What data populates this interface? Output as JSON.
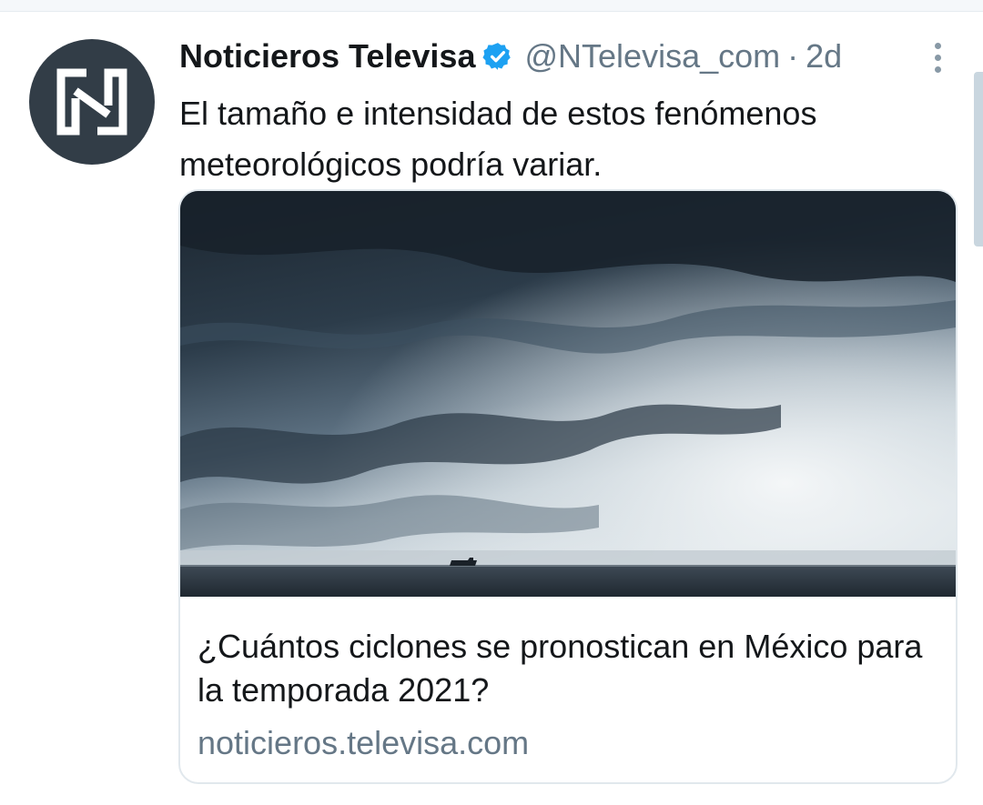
{
  "tweet": {
    "author": {
      "display_name": "Noticieros Televisa",
      "handle": "@NTelevisa_com",
      "verified": true,
      "avatar_icon": "noticieros-logo-icon"
    },
    "separator": "·",
    "time": "2d",
    "text": "El tamaño e intensidad de estos fenómenos meteorológicos podría variar.",
    "more_icon": "more-vertical-icon",
    "card": {
      "image_description_icon": "storm-clouds-over-sea-image",
      "title": "¿Cuántos ciclones se pronostican en México para la temporada 2021?",
      "url": "noticieros.televisa.com"
    }
  },
  "colors": {
    "primary_text": "#14171a",
    "secondary_text": "#657786",
    "verified_blue": "#1da1f2",
    "avatar_bg": "#323d47",
    "border": "#e1e8ed"
  }
}
